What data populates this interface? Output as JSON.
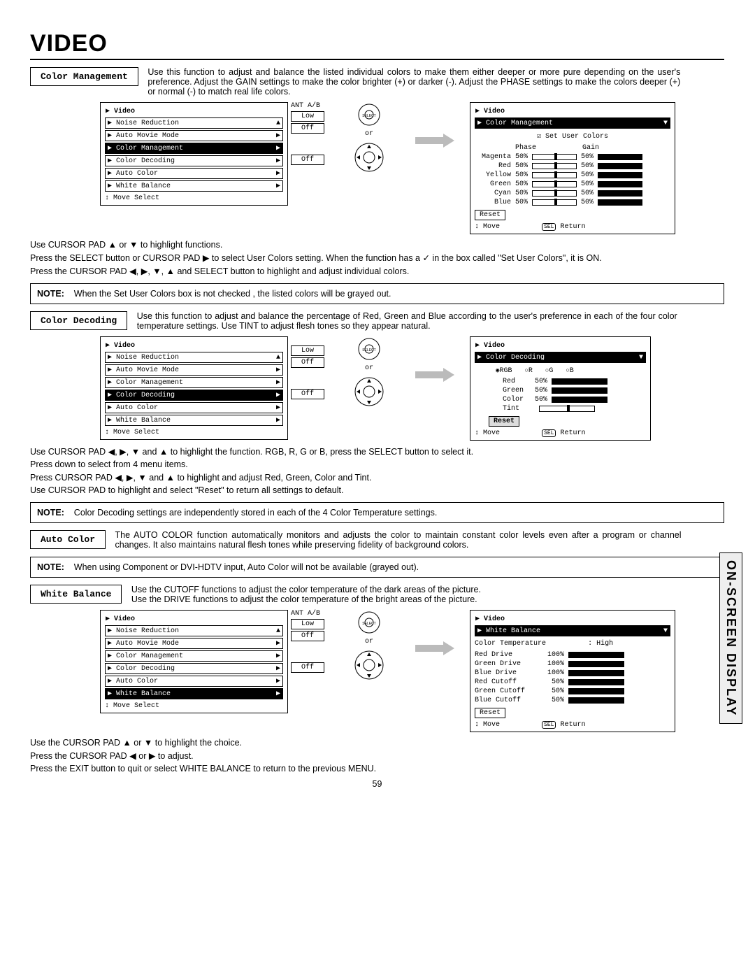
{
  "page_title": "VIDEO",
  "page_number": "59",
  "side_tab": "ON-SCREEN DISPLAY",
  "color_management": {
    "heading": "Color Management",
    "desc": "Use this function to adjust and balance the listed individual colors to make them either deeper or more pure depending on the user's preference. Adjust the GAIN settings to make the color brighter (+) or darker (-). Adjust the PHASE settings to make the colors deeper (+) or normal (-) to match real life colors.",
    "menu_left": {
      "title": "Video",
      "ant": "ANT A/B",
      "items": [
        "Noise Reduction",
        "Auto Movie Mode",
        "Color Management",
        "Color Decoding",
        "Auto Color",
        "White Balance"
      ],
      "highlight": 2,
      "vals": [
        "Low",
        "Off",
        "",
        "",
        "Off",
        ""
      ],
      "foot": "Move     Select"
    },
    "menu_right": {
      "title": "Video",
      "heading": "Color Management",
      "check_label": "Set User Colors",
      "phase": "Phase",
      "gain": "Gain",
      "rows": [
        {
          "n": "Magenta",
          "p": "50%",
          "g": "50%"
        },
        {
          "n": "Red",
          "p": "50%",
          "g": "50%"
        },
        {
          "n": "Yellow",
          "p": "50%",
          "g": "50%"
        },
        {
          "n": "Green",
          "p": "50%",
          "g": "50%"
        },
        {
          "n": "Cyan",
          "p": "50%",
          "g": "50%"
        },
        {
          "n": "Blue",
          "p": "50%",
          "g": "50%"
        }
      ],
      "reset": "Reset",
      "foot_l": "Move",
      "foot_r": "Return"
    },
    "inst1": "Use CURSOR PAD ▲ or ▼ to highlight functions.",
    "inst2": "Press the SELECT button or CURSOR PAD ▶ to select User Colors setting. When the function has a ✓ in the box called \"Set User Colors\", it is ON.",
    "inst3": "Press the CURSOR PAD ◀, ▶, ▼, ▲ and SELECT button to highlight and adjust individual colors.",
    "note": "When the Set User Colors box is not checked , the listed colors will be grayed out."
  },
  "color_decoding": {
    "heading": "Color Decoding",
    "desc": "Use this function to adjust and balance the percentage of Red, Green and Blue according to the user's preference in each of the four color temperature settings. Use TINT to adjust flesh tones so they appear natural.",
    "menu_left": {
      "title": "Video",
      "items": [
        "Noise Reduction",
        "Auto Movie Mode",
        "Color Management",
        "Color Decoding",
        "Auto Color",
        "White Balance"
      ],
      "highlight": 3,
      "vals": [
        "Low",
        "Off",
        "",
        "",
        "Off",
        ""
      ],
      "foot": "Move     Select"
    },
    "menu_right": {
      "title": "Video",
      "heading": "Color Decoding",
      "radios": [
        "RGB",
        "R",
        "G",
        "B"
      ],
      "rows": [
        {
          "n": "Red",
          "v": "50%"
        },
        {
          "n": "Green",
          "v": "50%"
        },
        {
          "n": "Color",
          "v": "50%"
        },
        {
          "n": "Tint",
          "v": ""
        }
      ],
      "reset": "Reset",
      "foot_l": "Move",
      "foot_r": "Return"
    },
    "inst1": "Use CURSOR PAD ◀, ▶, ▼ and ▲ to highlight the function. RGB, R, G or B, press the SELECT button to select it.",
    "inst2": "Press down to select from 4 menu items.",
    "inst3": "Press CURSOR PAD ◀, ▶, ▼ and ▲ to highlight and adjust Red, Green, Color and Tint.",
    "inst4": "Use CURSOR PAD to highlight and select \"Reset\" to return all settings to default.",
    "note": "Color Decoding settings are independently stored in each of the 4 Color Temperature settings."
  },
  "auto_color": {
    "heading": "Auto Color",
    "desc": "The AUTO COLOR function automatically monitors and adjusts the color to maintain constant color levels even after a program or channel changes. It also maintains natural flesh tones while preserving fidelity of background colors.",
    "note": "When using Component or DVI-HDTV input, Auto Color will not be available (grayed out)."
  },
  "white_balance": {
    "heading": "White Balance",
    "desc1": "Use the CUTOFF functions to adjust the color temperature of the dark areas of the picture.",
    "desc2": "Use the DRIVE functions to adjust the color temperature of the bright areas of the picture.",
    "menu_left": {
      "title": "Video",
      "ant": "ANT A/B",
      "items": [
        "Noise Reduction",
        "Auto Movie Mode",
        "Color Management",
        "Color Decoding",
        "Auto Color",
        "White Balance"
      ],
      "highlight": 5,
      "vals": [
        "Low",
        "Off",
        "",
        "",
        "Off",
        ""
      ],
      "foot": "Move     Select"
    },
    "menu_right": {
      "title": "Video",
      "heading": "White Balance",
      "temp_label": "Color Temperature",
      "temp_val": ": High",
      "rows": [
        {
          "n": "Red   Drive",
          "v": "100%",
          "f": 100
        },
        {
          "n": "Green Drive",
          "v": "100%",
          "f": 100
        },
        {
          "n": "Blue  Drive",
          "v": "100%",
          "f": 100
        },
        {
          "n": "Red   Cutoff",
          "v": "50%",
          "f": 50
        },
        {
          "n": "Green Cutoff",
          "v": "50%",
          "f": 50
        },
        {
          "n": "Blue  Cutoff",
          "v": "50%",
          "f": 50
        }
      ],
      "reset": "Reset",
      "foot_l": "Move",
      "foot_r": "Return"
    },
    "inst1": "Use the CURSOR PAD ▲ or ▼ to highlight the choice.",
    "inst2": "Press the CURSOR PAD ◀ or ▶ to adjust.",
    "inst3": "Press the EXIT button to quit or select WHITE BALANCE to return to the previous MENU."
  },
  "labels": {
    "note": "NOTE:",
    "or": "or",
    "arrows": "▶"
  }
}
